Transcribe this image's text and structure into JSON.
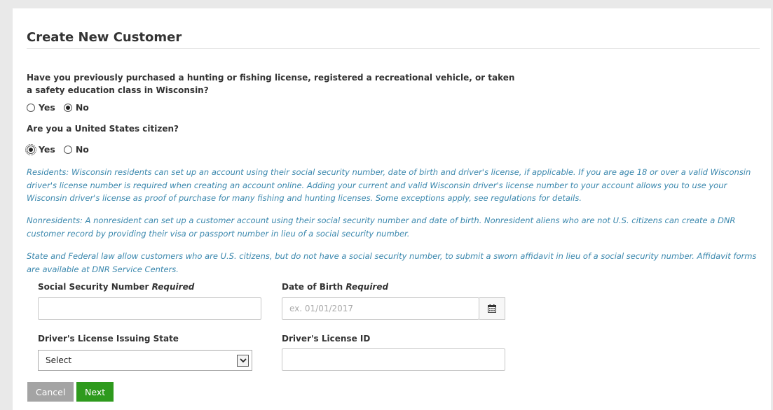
{
  "form": {
    "title": "Create New Customer",
    "q1": {
      "text": "Have you previously purchased a hunting or fishing license, registered a recreational vehicle, or taken a safety education class in Wisconsin?",
      "options": [
        "Yes",
        "No"
      ],
      "selected": "No"
    },
    "q2": {
      "text": "Are you a United States citizen?",
      "options": [
        "Yes",
        "No"
      ],
      "selected": "Yes"
    },
    "info": {
      "residents": "Residents: Wisconsin residents can set up an account using their social security number, date of birth and driver's license, if applicable. If you are age 18 or over a valid Wisconsin driver's license number is required when creating an account online. Adding your current and valid Wisconsin driver's license number to your account allows you to use your Wisconsin driver's license as proof of purchase for many fishing and hunting licenses. Some exceptions apply, see regulations for details.",
      "nonresidents": "Nonresidents: A nonresident can set up a customer account using their social security number and date of birth. Nonresident aliens who are not U.S. citizens can create a DNR customer record by providing their visa or passport number in lieu of a social security number.",
      "affidavit": "State and Federal law allow customers who are U.S. citizens, but do not have a social security number, to submit a sworn affidavit in lieu of a social security number. Affidavit forms are available at DNR Service Centers."
    },
    "fields": {
      "ssn": {
        "label": "Social Security Number",
        "required_label": "Required",
        "value": ""
      },
      "dob": {
        "label": "Date of Birth",
        "required_label": "Required",
        "placeholder": "ex. 01/01/2017",
        "value": ""
      },
      "dl_state": {
        "label": "Driver's License Issuing State",
        "selected": "Select"
      },
      "dl_id": {
        "label": "Driver's License ID",
        "value": ""
      }
    },
    "buttons": {
      "cancel": "Cancel",
      "next": "Next"
    }
  },
  "colors": {
    "info_text": "#3a87ad",
    "next_button": "#2e9a1d",
    "cancel_button": "#a4a4a4"
  },
  "icons": {
    "calendar": "calendar-icon",
    "dropdown": "chevron-down-icon"
  }
}
